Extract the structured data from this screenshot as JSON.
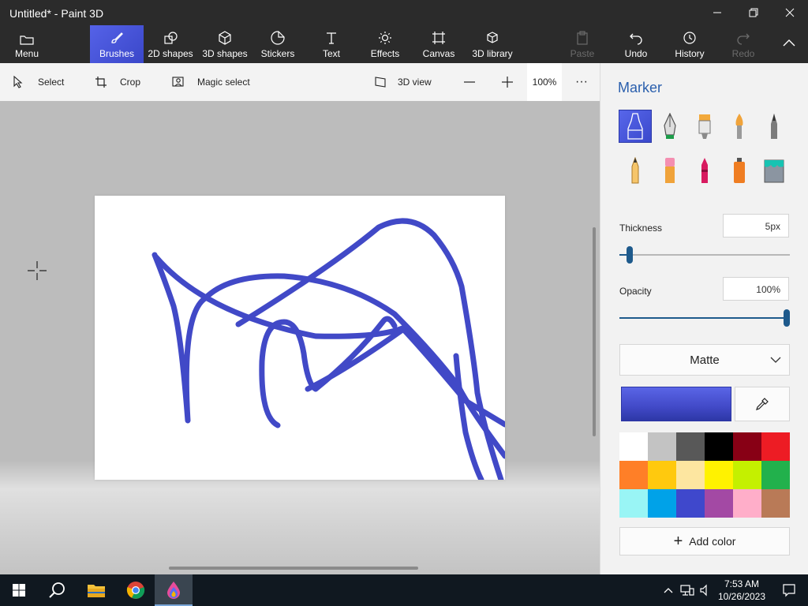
{
  "window": {
    "title": "Untitled* - Paint 3D"
  },
  "ribbon": {
    "menu_label": "Menu",
    "tabs": [
      {
        "label": "Brushes"
      },
      {
        "label": "2D shapes"
      },
      {
        "label": "3D shapes"
      },
      {
        "label": "Stickers"
      },
      {
        "label": "Text"
      },
      {
        "label": "Effects"
      },
      {
        "label": "Canvas"
      },
      {
        "label": "3D library"
      }
    ],
    "actions": [
      {
        "label": "Paste"
      },
      {
        "label": "Undo"
      },
      {
        "label": "History"
      },
      {
        "label": "Redo"
      }
    ]
  },
  "toolbar": {
    "select_label": "Select",
    "crop_label": "Crop",
    "magic_select_label": "Magic select",
    "view3d_label": "3D view",
    "zoom_out_label": "—",
    "zoom_in_label": "+",
    "zoom_value": "100%",
    "more_label": "···"
  },
  "panel": {
    "title": "Marker",
    "brushes": [
      "marker",
      "calligraphy-pen",
      "oil-brush",
      "watercolor",
      "pixel-pen",
      "pencil",
      "eraser",
      "crayon",
      "spray-can",
      "fill"
    ],
    "thickness_label": "Thickness",
    "thickness_value": "5px",
    "thickness_fraction": 0.06,
    "opacity_label": "Opacity",
    "opacity_value": "100%",
    "opacity_fraction": 1.0,
    "finish": "Matte",
    "current_color": "#4149c7",
    "palette": [
      "#ffffff",
      "#c3c3c3",
      "#585858",
      "#000000",
      "#880015",
      "#ed1c24",
      "#ff7f27",
      "#ffc90e",
      "#fde6a0",
      "#fff200",
      "#c4f000",
      "#22b14c",
      "#99f5f5",
      "#00a2e8",
      "#3f48cc",
      "#a349a4",
      "#ffaec9",
      "#b97a57"
    ],
    "add_color_label": "Add color"
  },
  "taskbar": {
    "time": "7:53 AM",
    "date": "10/26/2023"
  }
}
